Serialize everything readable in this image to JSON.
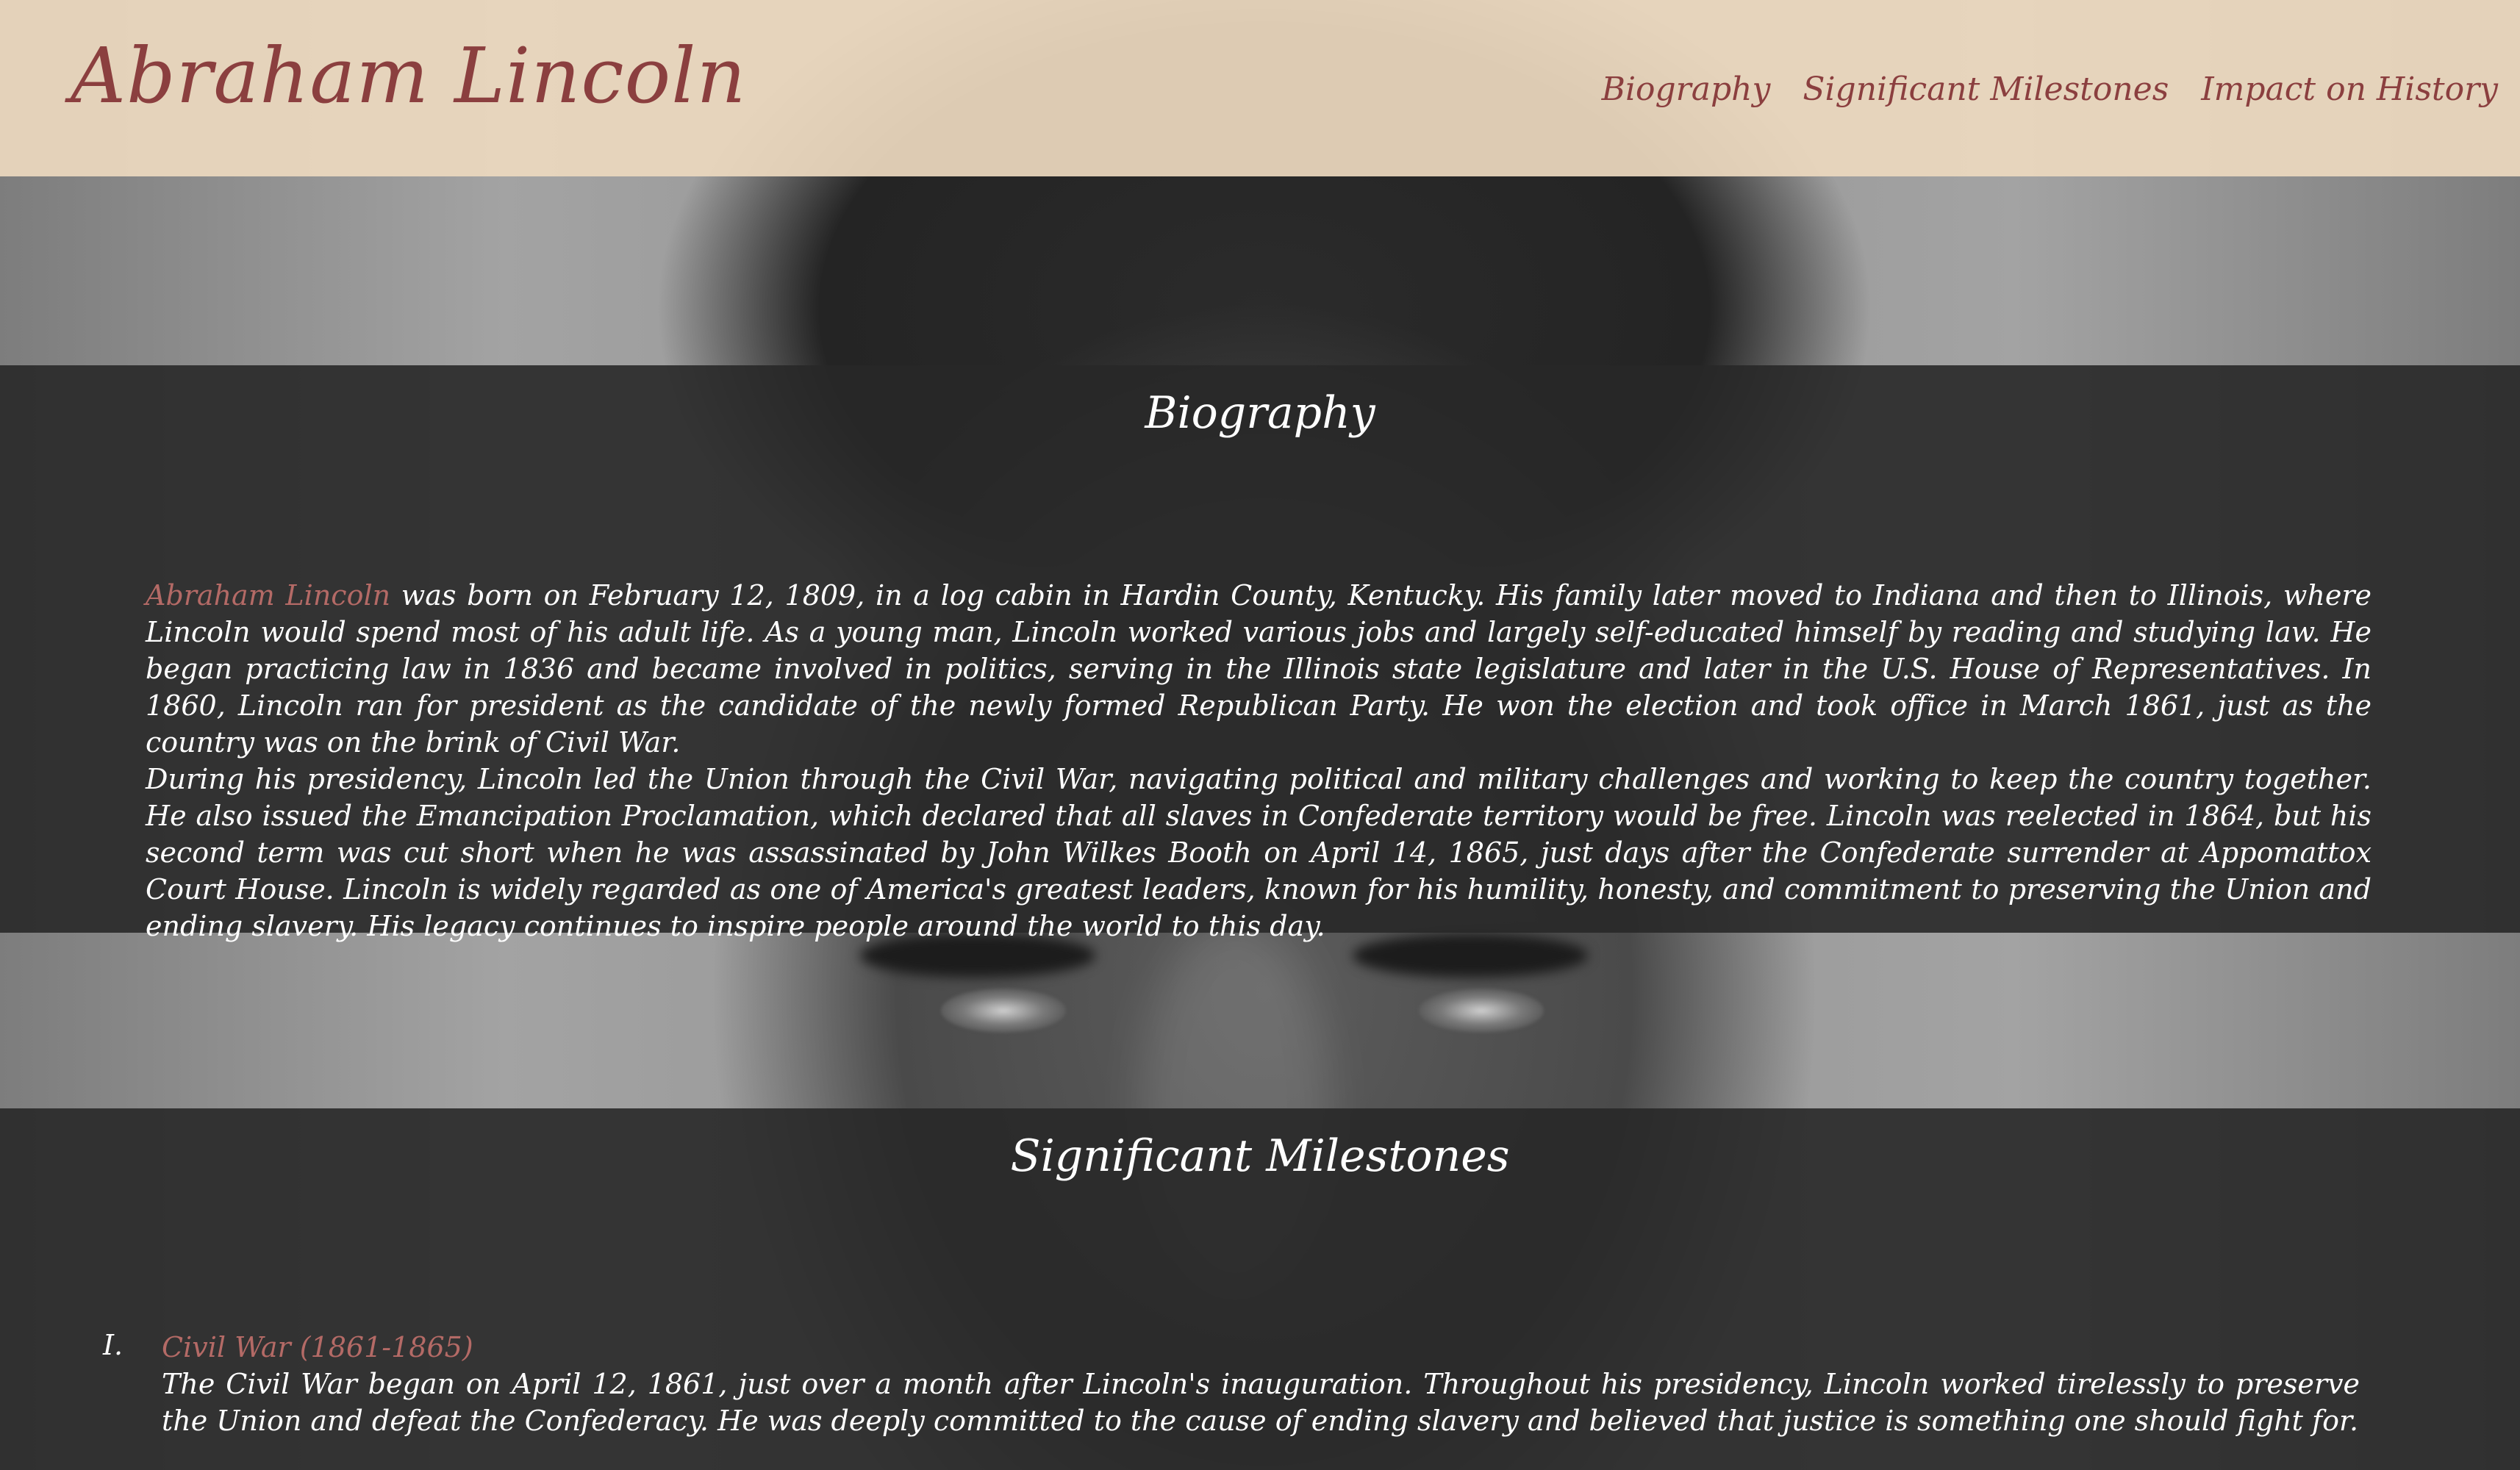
{
  "header": {
    "logo": "Abraham Lincoln",
    "nav": [
      {
        "label": "Biography"
      },
      {
        "label": "Significant Milestones"
      },
      {
        "label": "Impact on History"
      }
    ]
  },
  "biography": {
    "heading": "Biography",
    "highlight_name": "Abraham Lincoln",
    "paragraph1_rest": " was born on February 12, 1809, in a log cabin in Hardin County, Kentucky. His family later moved to Indiana and then to Illinois, where Lincoln would spend most of his adult life. As a young man, Lincoln worked various jobs and largely self-educated himself by reading and studying law. He began practicing law in 1836 and became involved in politics, serving in the Illinois state legislature and later in the U.S. House of Representatives. In 1860, Lincoln ran for president as the candidate of the newly formed Republican Party. He won the election and took office in March 1861, just as the country was on the brink of Civil War.",
    "paragraph2": "During his presidency, Lincoln led the Union through the Civil War, navigating political and military challenges and working to keep the country together. He also issued the Emancipation Proclamation, which declared that all slaves in Confederate territory would be free. Lincoln was reelected in 1864, but his second term was cut short when he was assassinated by John Wilkes Booth on April 14, 1865, just days after the Confederate surrender at Appomattox Court House. Lincoln is widely regarded as one of America's greatest leaders, known for his humility, honesty, and commitment to preserving the Union and ending slavery. His legacy continues to inspire people around the world to this day."
  },
  "milestones": {
    "heading": "Significant Milestones",
    "items": [
      {
        "number": "I.",
        "title": "Civil War (1861-1865)",
        "description": "The Civil War began on April 12, 1861, just over a month after Lincoln's inauguration. Throughout his presidency, Lincoln worked tirelessly to preserve the Union and defeat the Confederacy. He was deeply committed to the cause of ending slavery and believed that justice is something one should fight for."
      }
    ]
  },
  "colors": {
    "accent": "#8b3f3f",
    "accent_light": "#b46a66",
    "header_bg": "#ecd8be",
    "section_bg": "#282828"
  }
}
